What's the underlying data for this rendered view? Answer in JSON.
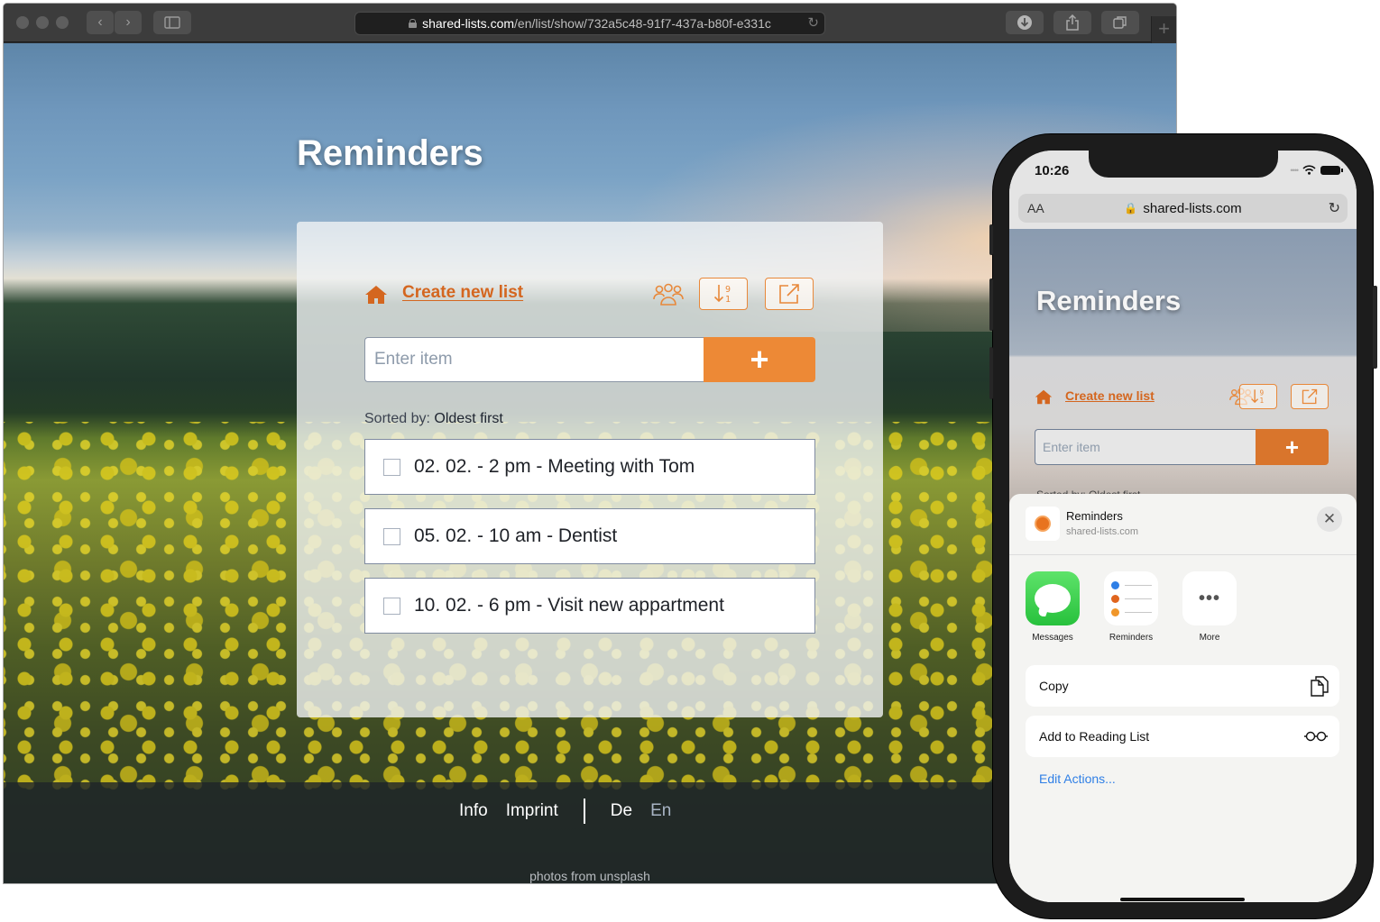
{
  "browser": {
    "url_host": "shared-lists.com",
    "url_path": "/en/list/show/732a5c48-91f7-437a-b80f-e331c",
    "toolbar": {
      "back_icon": "chevron-left-icon",
      "forward_icon": "chevron-right-icon",
      "sidebar_icon": "sidebar-icon",
      "download_icon": "download-icon",
      "share_icon": "share-icon",
      "tabs_icon": "tabs-overview-icon",
      "new_tab_icon": "plus-icon"
    }
  },
  "page": {
    "title": "Reminders",
    "create_new_list": "Create new list",
    "input_placeholder": "Enter item",
    "add_button": "+",
    "sorted_label": "Sorted by:",
    "sorted_value": "Oldest first",
    "items": [
      {
        "text": "02. 02. - 2 pm - Meeting with Tom",
        "checked": false
      },
      {
        "text": "05. 02. - 10 am - Dentist",
        "checked": false
      },
      {
        "text": "10. 02. - 6 pm - Visit new appartment",
        "checked": false
      }
    ],
    "footer": {
      "links": [
        "Info",
        "Imprint"
      ],
      "languages": [
        {
          "label": "De",
          "active": false
        },
        {
          "label": "En",
          "active": true
        }
      ],
      "credit": "photos from unsplash"
    },
    "accent_color": "#ed8936",
    "link_color": "#d4661f"
  },
  "phone": {
    "time": "10:26",
    "url_text_size": "AA",
    "url_host": "shared-lists.com",
    "page_title": "Reminders",
    "create_new_list": "Create new list",
    "input_placeholder": "Enter item",
    "add_button": "+",
    "sorted_text": "Sorted by: Oldest first",
    "share_sheet": {
      "title": "Reminders",
      "subtitle": "shared-lists.com",
      "apps": [
        {
          "label": "Messages",
          "icon": "messages-icon"
        },
        {
          "label": "Reminders",
          "icon": "reminders-icon"
        },
        {
          "label": "More",
          "icon": "more-icon"
        }
      ],
      "actions": [
        {
          "label": "Copy",
          "icon": "copy-icon"
        },
        {
          "label": "Add to Reading List",
          "icon": "reading-glasses-icon"
        }
      ],
      "edit_actions": "Edit Actions..."
    }
  }
}
